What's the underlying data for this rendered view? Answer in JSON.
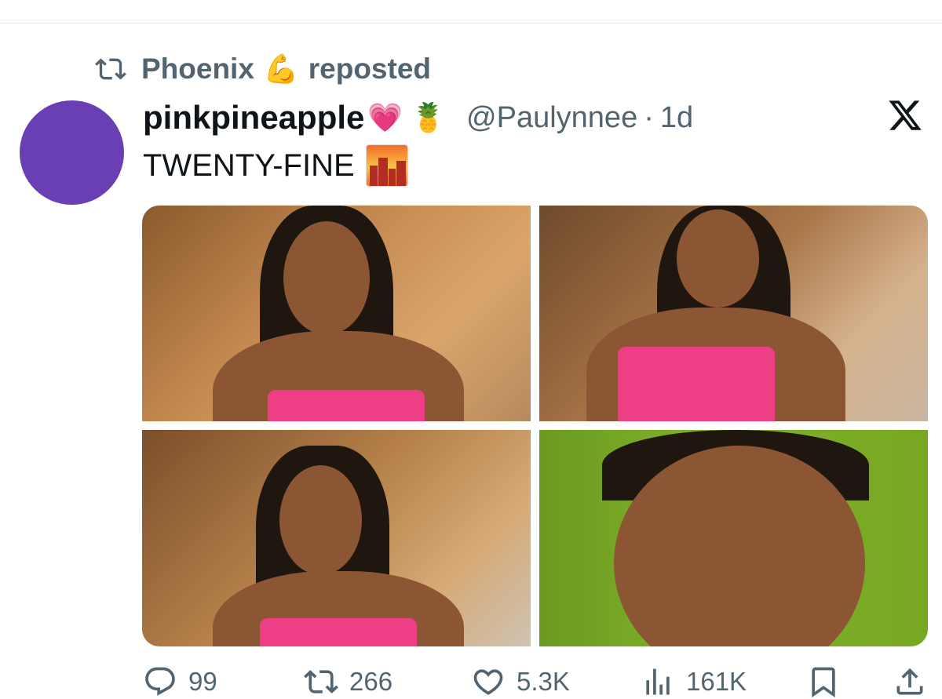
{
  "repost": {
    "user": "Phoenix",
    "emoji": "💪",
    "label": "reposted"
  },
  "tweet": {
    "display_name": "pinkpineapple",
    "name_emojis": "💗 🍍",
    "handle": "@Paulynnee",
    "separator": "·",
    "time": "1d",
    "text": "TWENTY-FINE"
  },
  "icons": {
    "repost": "repost-icon",
    "x_logo": "x-logo-icon",
    "reply": "reply-icon",
    "like": "heart-icon",
    "views": "views-icon",
    "bookmark": "bookmark-icon",
    "share": "share-icon",
    "city": "cityscape-at-dusk-emoji"
  },
  "actions": {
    "replies": "99",
    "reposts": "266",
    "likes": "5.3K",
    "views": "161K"
  },
  "colors": {
    "avatar": "#6a3fb4",
    "secondary_text": "#536471",
    "primary_text": "#0f1419"
  }
}
